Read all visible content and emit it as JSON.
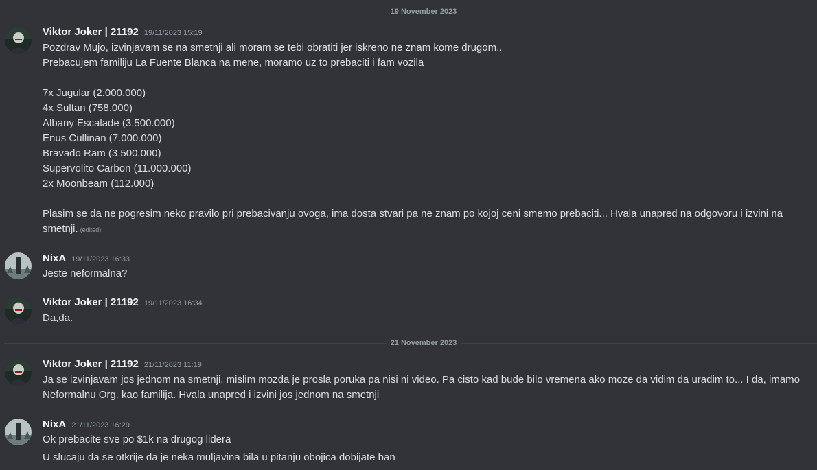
{
  "dividers": [
    {
      "label": "19 November 2023"
    },
    {
      "label": "21 November 2023"
    }
  ],
  "messages": [
    {
      "author": "Viktor Joker | 21192",
      "timestamp": "19/11/2023 15:19",
      "lines": [
        "Pozdrav Mujo, izvinjavam se na smetnji ali moram se tebi obratiti jer iskreno ne znam kome drugom..",
        "Prebacujem familiju La Fuente Blanca na mene, moramo uz to prebaciti i fam vozila",
        "7x Jugular (2.000.000)",
        "4x Sultan (758.000)",
        "Albany Escalade (3.500.000)",
        "Enus Cullinan (7.000.000)",
        "Bravado Ram (3.500.000)",
        "Supervolito Carbon (11.000.000)",
        "2x Moonbeam (112.000)",
        "Plasim se da ne pogresim neko pravilo pri prebacivanju ovoga, ima dosta stvari pa ne znam po kojoj ceni smemo prebaciti... Hvala unapred na odgovoru i izvini na",
        "smetnji."
      ],
      "edited_label": "(edited)"
    },
    {
      "author": "NixA",
      "timestamp": "19/11/2023 16:33",
      "lines": [
        "Jeste neformalna?"
      ]
    },
    {
      "author": "Viktor Joker | 21192",
      "timestamp": "19/11/2023 16:34",
      "lines": [
        "Da,da."
      ]
    },
    {
      "author": "Viktor Joker | 21192",
      "timestamp": "21/11/2023 11:19",
      "lines": [
        "Ja se izvinjavam jos jednom na smetnji, mislim mozda je prosla poruka pa nisi ni video. Pa cisto kad bude bilo vremena ako moze da vidim da uradim to... I da, imamo",
        "Neformalnu Org. kao familija. Hvala unapred i izvini jos jednom na smetnji"
      ]
    },
    {
      "author": "NixA",
      "timestamp": "21/11/2023 16:29",
      "lines": [
        "Ok prebacite sve po $1k na drugog lidera",
        "U slucaju da se otkrije da je neka muljavina bila u pitanju obojica dobijate ban"
      ]
    }
  ],
  "colors": {
    "background": "#313338",
    "username": "#f2f3f5",
    "text": "#dbdee1",
    "muted": "#949ba4",
    "divider": "#3f4147"
  }
}
